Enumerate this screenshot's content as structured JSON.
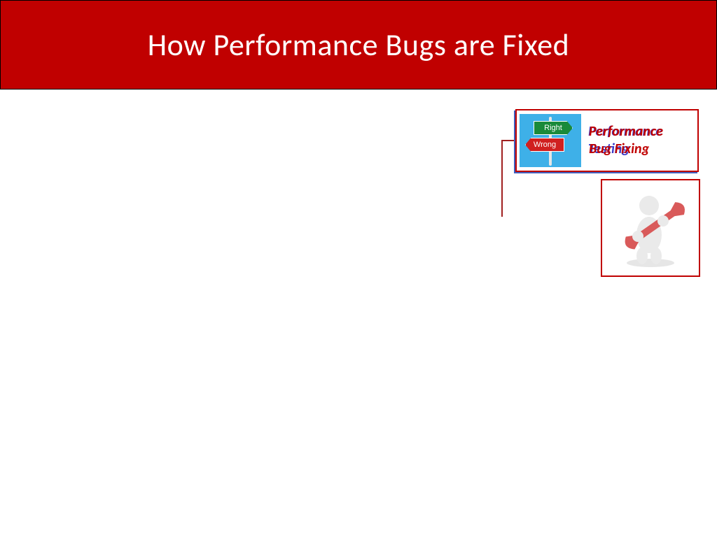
{
  "slide": {
    "title": "How Performance Bugs are Fixed"
  },
  "card": {
    "sign_right": "Right",
    "sign_wrong": "Wrong",
    "text_layer1_line1": "Performance",
    "text_layer1_line2": "Testing",
    "text_layer2_line1": "Performance",
    "text_layer2_line2": "Bug Fixing"
  },
  "colors": {
    "brand_red": "#c00000",
    "accent_blue": "#3a3ac8",
    "sky": "#3eb0e8"
  }
}
